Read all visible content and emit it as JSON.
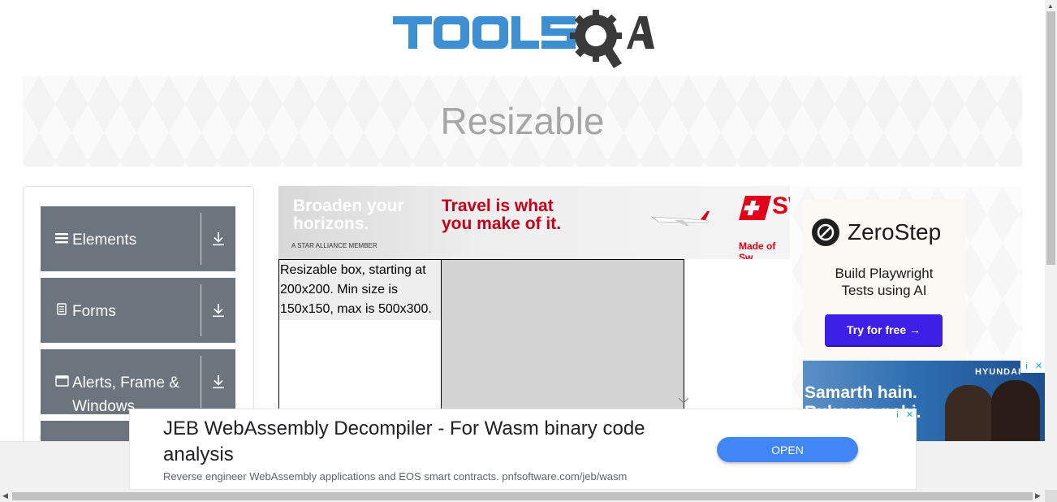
{
  "logo": {
    "text": "TOOLSQA"
  },
  "banner": {
    "title": "Resizable"
  },
  "sidebar": {
    "groups": [
      {
        "label": "Elements",
        "icon": "hamburger-icon"
      },
      {
        "label": "Forms",
        "icon": "document-icon"
      },
      {
        "label": "Alerts, Frame &",
        "label2": "Windows",
        "icon": "window-icon"
      }
    ]
  },
  "ad_top": {
    "line1": "Broaden your",
    "line2": "horizons.",
    "member": "A STAR ALLIANCE MEMBER",
    "red1": "Travel is what",
    "red2": "you make of it.",
    "brand_fragment": "SW",
    "made": "Made of Sw"
  },
  "resizable": {
    "text": "Resizable box, starting at 200x200. Min size is 150x150, max is 500x300."
  },
  "zerostep": {
    "name": "ZeroStep",
    "subtitle1": "Build Playwright",
    "subtitle2": "Tests using AI",
    "button": "Try for free →"
  },
  "hyundai": {
    "line1": "Samarth hain.",
    "line2": "Rukenge nahi.",
    "brand": "HYUNDAI"
  },
  "ad_bottom": {
    "title": "JEB WebAssembly Decompiler - For Wasm binary code analysis",
    "description": "Reverse engineer WebAssembly applications and EOS smart contracts. pnfsoftware.com/jeb/wasm",
    "button": "OPEN"
  },
  "colors": {
    "sidebar_group_bg": "#6c757d",
    "zerostep_button": "#3e1fe6",
    "open_button": "#4285f4",
    "logo_blue": "#3d8fd1",
    "logo_dark": "#3a3a3a"
  }
}
